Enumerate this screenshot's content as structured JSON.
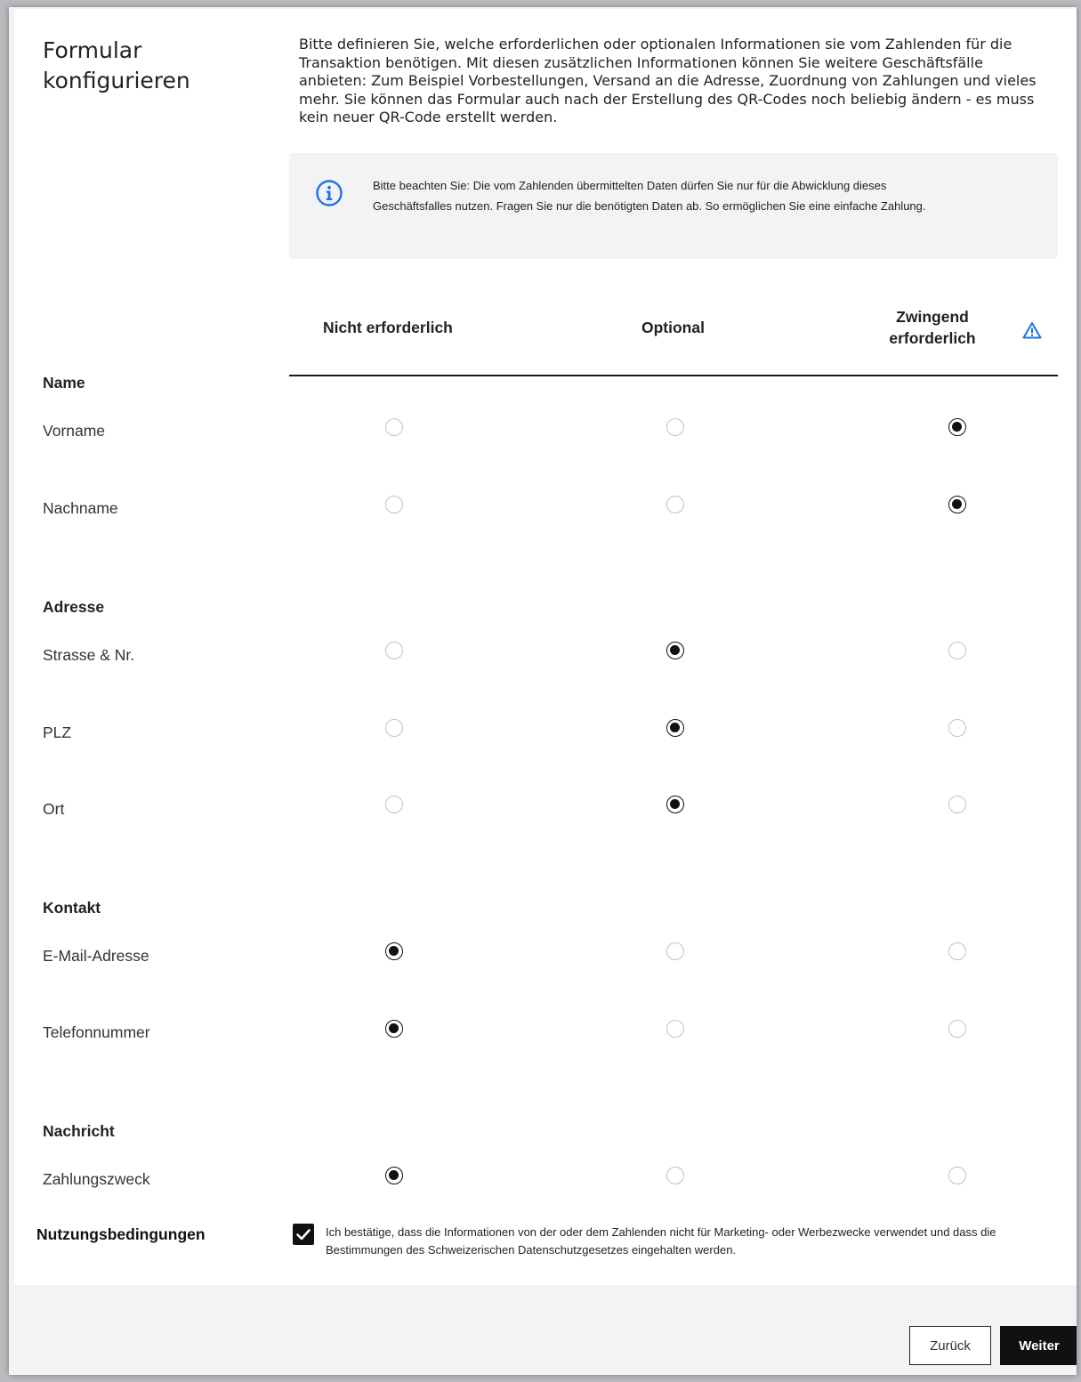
{
  "page": {
    "title": "Formular konfigurieren",
    "intro": "Bitte definieren Sie, welche erforderlichen oder optionalen Informationen sie vom Zahlenden für die Transaktion benötigen. Mit diesen zusätzlichen Informationen können Sie weitere Geschäftsfälle anbieten: Zum Beispiel  Vorbestellungen, Versand an die Adresse, Zuordnung von Zahlungen und vieles mehr. Sie können das Formular auch nach der Erstellung des QR-Codes noch beliebig ändern - es muss kein neuer QR-Code erstellt werden."
  },
  "notice": {
    "icon": "info-icon",
    "text": "Bitte beachten Sie: Die vom Zahlenden übermittelten Daten dürfen Sie nur für die Abwicklung dieses Geschäftsfalles nutzen. Fragen Sie nur die benötigten Daten ab. So ermöglichen Sie eine einfache Zahlung."
  },
  "columns": {
    "not_required": "Nicht erforderlich",
    "optional": "Optional",
    "required": "Zwingend erforderlich",
    "required_icon": "warning-triangle-icon"
  },
  "groups": {
    "name": "Name",
    "address": "Adresse",
    "contact": "Kontakt",
    "message": "Nachricht"
  },
  "fields": {
    "vorname": {
      "label": "Vorname",
      "selected": "required"
    },
    "nachname": {
      "label": "Nachname",
      "selected": "required"
    },
    "strasse": {
      "label": "Strasse & Nr.",
      "selected": "optional"
    },
    "plz": {
      "label": "PLZ",
      "selected": "optional"
    },
    "ort": {
      "label": "Ort",
      "selected": "optional"
    },
    "email": {
      "label": "E-Mail-Adresse",
      "selected": "not_required"
    },
    "telefon": {
      "label": "Telefonnummer",
      "selected": "not_required"
    },
    "zahlungszweck": {
      "label": "Zahlungszweck",
      "selected": "not_required"
    }
  },
  "terms": {
    "label": "Nutzungsbedingungen",
    "checked": true,
    "text": "Ich bestätige, dass die Informationen von der oder dem Zahlenden nicht für Marketing- oder Werbezwecke verwendet und dass die Bestimmungen des Schweizerischen Datenschutzgesetzes eingehalten werden."
  },
  "buttons": {
    "back": "Zurück",
    "next": "Weiter"
  },
  "colors": {
    "accent_blue": "#1a73e8",
    "primary_dark": "#111111"
  }
}
